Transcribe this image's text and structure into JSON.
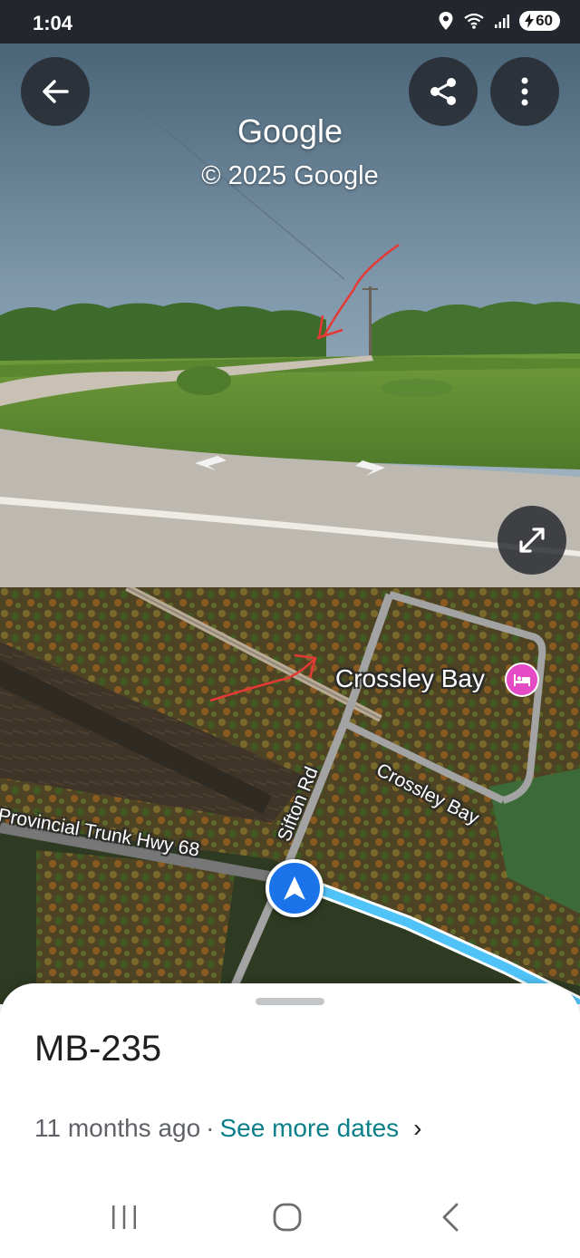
{
  "status_bar": {
    "time": "1:04",
    "battery_level": "60",
    "icons": [
      "location-icon",
      "wifi-icon",
      "signal-icon",
      "battery-charging-icon"
    ]
  },
  "street_view": {
    "title": "Google",
    "copyright": "© 2025 Google",
    "buttons": [
      "back-icon",
      "share-icon",
      "more-vert-icon",
      "fullscreen-icon"
    ]
  },
  "map": {
    "labels": {
      "crossley_bay_place": "Crossley Bay",
      "crossley_bay_road": "Crossley Bay",
      "sifton_rd": "Sifton Rd",
      "highway": "Provincial Trunk Hwy 68"
    },
    "colors": {
      "route": "#4fc3f7",
      "hotel_pin": "#e44bc4",
      "nav_pin": "#1a73e8",
      "annotation_arrow": "#e53935"
    }
  },
  "sheet": {
    "title": "MB-235",
    "date_text": "11 months ago",
    "separator": "·",
    "see_more": "See more dates",
    "chevron": "›"
  },
  "nav_bar": {
    "buttons": [
      "recents-icon",
      "home-icon",
      "back-nav-icon"
    ]
  }
}
